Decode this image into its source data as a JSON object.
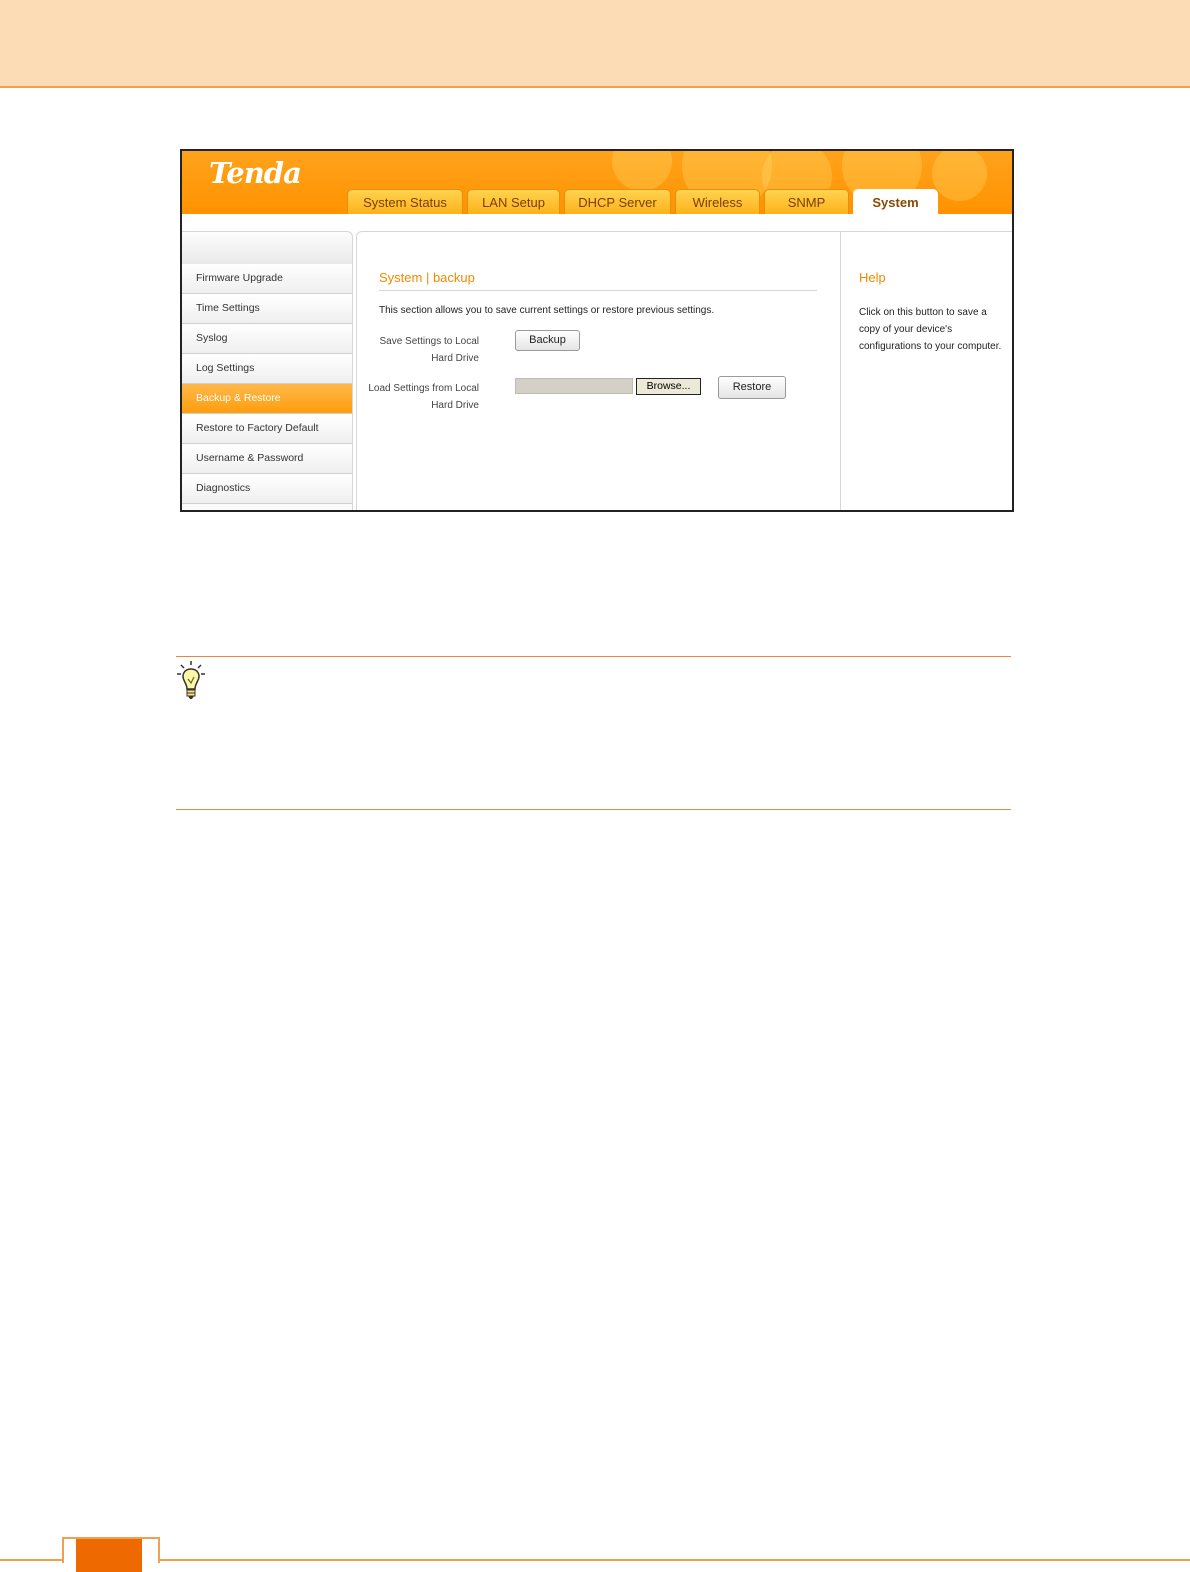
{
  "app": {
    "logo": "Tenda"
  },
  "tabs": [
    {
      "label": "System Status",
      "active": false
    },
    {
      "label": "LAN Setup",
      "active": false
    },
    {
      "label": "DHCP Server",
      "active": false
    },
    {
      "label": "Wireless",
      "active": false
    },
    {
      "label": "SNMP",
      "active": false
    },
    {
      "label": "System",
      "active": true
    }
  ],
  "sidebar": {
    "items": [
      {
        "label": "Firmware Upgrade",
        "active": false
      },
      {
        "label": "Time Settings",
        "active": false
      },
      {
        "label": "Syslog",
        "active": false
      },
      {
        "label": "Log Settings",
        "active": false
      },
      {
        "label": "Backup & Restore",
        "active": true
      },
      {
        "label": "Restore to Factory Default",
        "active": false
      },
      {
        "label": "Username & Password",
        "active": false
      },
      {
        "label": "Diagnostics",
        "active": false
      }
    ]
  },
  "main": {
    "title": "System | backup",
    "description": "This section allows you to save current settings or restore previous settings.",
    "save_label_line1": "Save Settings to Local",
    "save_label_line2": "Hard Drive",
    "backup_button": "Backup",
    "load_label_line1": "Load Settings from Local",
    "load_label_line2": "Hard Drive",
    "file_value": "",
    "browse_button": "Browse...",
    "restore_button": "Restore"
  },
  "help": {
    "title": "Help",
    "text": "Click on this button to save a copy of your device's configurations to your computer."
  },
  "colors": {
    "accent": "#ff9a0e",
    "title_orange": "#f08a00",
    "header_band": "#fcdcb4",
    "footer_tab": "#ee6a00"
  },
  "icons": {
    "tip": "lightbulb-icon"
  }
}
